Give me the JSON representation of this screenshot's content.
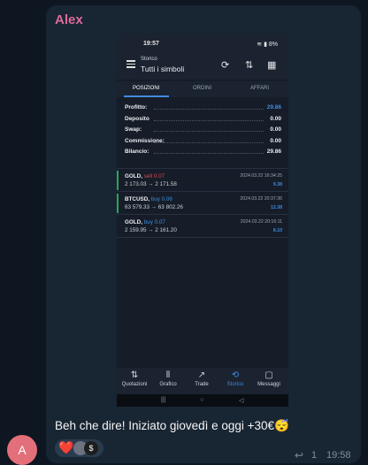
{
  "message": {
    "sender": "Alex",
    "text": "Beh che dire! Iniziato giovedì e oggi +30€😴",
    "avatar_initial": "A",
    "reply_count": "1",
    "time": "19:58",
    "reactions": {
      "heart": "❤️",
      "avatar2": "$"
    }
  },
  "screenshot": {
    "status": {
      "time": "19:57",
      "battery": "8%"
    },
    "header": {
      "label": "Storico",
      "subtitle": "Tutti i simboli"
    },
    "tabs": [
      {
        "label": "POSIZIONI",
        "active": true
      },
      {
        "label": "ORDINI",
        "active": false
      },
      {
        "label": "AFFARI",
        "active": false
      }
    ],
    "summary": [
      {
        "label": "Profitto:",
        "value": "29.86",
        "color": "#3f8ae0"
      },
      {
        "label": "Deposito",
        "value": "0.00"
      },
      {
        "label": "Swap:",
        "value": "0.00"
      },
      {
        "label": "Commissione:",
        "value": "0.00"
      },
      {
        "label": "Bilancio:",
        "value": "29.86"
      }
    ],
    "positions": [
      {
        "symbol": "GOLD,",
        "side": "sell 0.07",
        "side_color": "#e0444d",
        "prices": "2 173.03 → 2 171.58",
        "datetime": "2024.03.22 16:34:25",
        "profit": "9.38",
        "bar_color": "#26a65b"
      },
      {
        "symbol": "BTCUSD,",
        "side": "buy 0.06",
        "side_color": "#3f8ae0",
        "prices": "63 579.33 → 63 802.26",
        "datetime": "2024.03.22 20:37:36",
        "profit": "12.38",
        "bar_color": "#26a65b"
      },
      {
        "symbol": "GOLD,",
        "side": "buy 0.07",
        "side_color": "#3f8ae0",
        "prices": "2 159.95 → 2 161.20",
        "datetime": "2024.03.22 20:16:11",
        "profit": "8.10",
        "bar_color": ""
      }
    ],
    "nav": [
      {
        "label": "Quotazioni",
        "icon": "⇅"
      },
      {
        "label": "Grafico",
        "icon": "⫴"
      },
      {
        "label": "Trade",
        "icon": "↗"
      },
      {
        "label": "Storico",
        "icon": "⟲",
        "active": true
      },
      {
        "label": "Messaggi",
        "icon": "▢"
      }
    ]
  },
  "colors": {
    "accent": "#3f8ae0",
    "sender": "#dd6b9a",
    "sell": "#e0444d",
    "buy": "#3f8ae0"
  }
}
